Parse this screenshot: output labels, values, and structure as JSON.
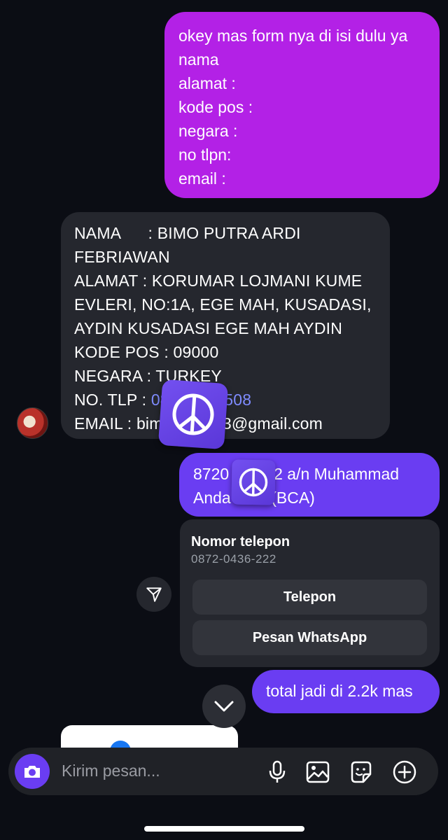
{
  "messages": {
    "form_request": {
      "lines": [
        "okey mas form nya di isi dulu ya",
        "nama",
        "alamat :",
        "kode pos :",
        "negara :",
        "no tlpn:",
        "email :"
      ]
    },
    "form_reply": {
      "nama_line1": "NAMA      : BIMO PUTRA ARDI",
      "nama_line2": "FEBRIAWAN",
      "alamat_line1": "ALAMAT : KORUMAR LOJMANI KUME",
      "alamat_line2": "EVLERI, NO:1A, EGE MAH, KUSADASI,",
      "alamat_line3": "AYDIN KUSADASI EGE MAH AYDIN",
      "kode_pos": "KODE POS : 09000",
      "negara": "NEGARA : TURKEY",
      "tlp_label": "NO. TLP : ",
      "tlp_value": "08      449508",
      "email": "EMAIL : bim         503@gmail.com"
    },
    "account_info": {
      "line1": "8720        22 a/n Muhammad",
      "line2": "Anda         (BCA)"
    },
    "total": {
      "text": "total jadi di 2.2k mas"
    }
  },
  "phone_card": {
    "title": "Nomor telepon",
    "number": "0872-0436-222",
    "call_label": "Telepon",
    "whatsapp_label": "Pesan WhatsApp"
  },
  "composer": {
    "placeholder": "Kirim pesan..."
  },
  "icons": {
    "sticker": "peace-sign-icon",
    "share": "send-icon",
    "scroll": "chevron-down-icon",
    "camera": "camera-icon",
    "mic": "microphone-icon",
    "gallery": "gallery-icon",
    "sticker_picker": "sticker-icon",
    "add": "plus-circle-icon"
  },
  "colors": {
    "background": "#0b0d14",
    "outgoing_magenta": "#b321e6",
    "outgoing_purple": "#6a3df2",
    "incoming": "#25272e",
    "link": "#7f8cff"
  }
}
